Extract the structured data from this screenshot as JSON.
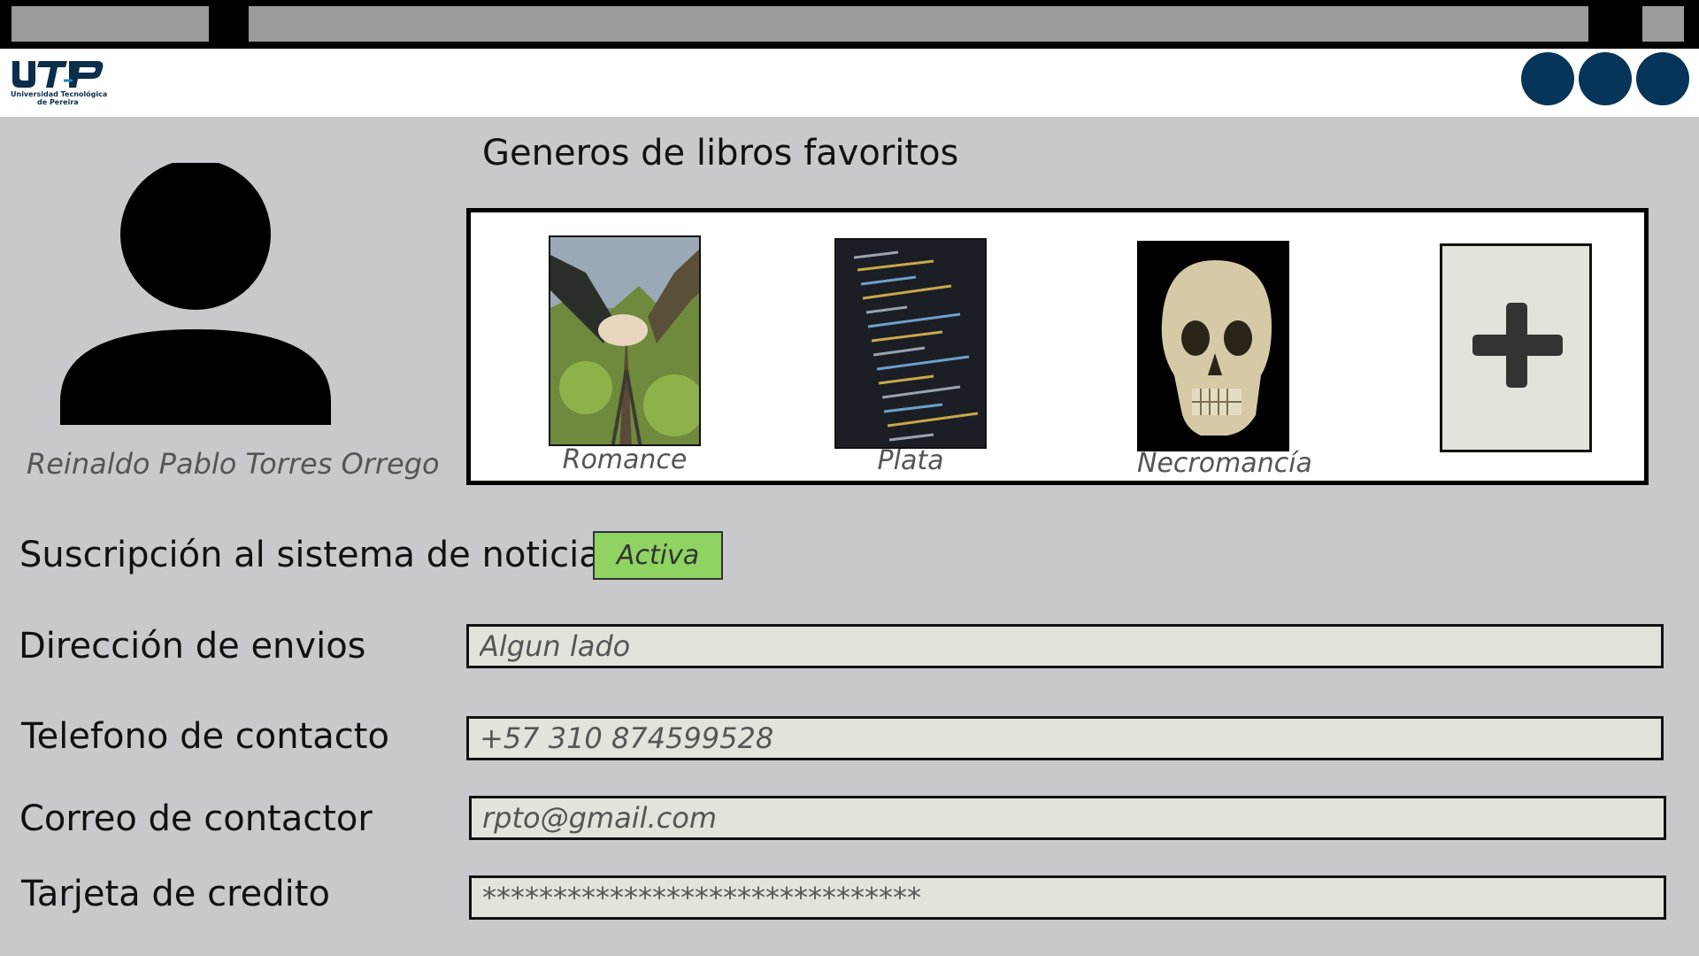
{
  "logo": {
    "text": "UTP",
    "subtitle_line1": "Universidad Tecnológica",
    "subtitle_line2": "de Pereira"
  },
  "profile": {
    "name": "Reinaldo Pablo Torres Orrego"
  },
  "genres": {
    "title": "Generos de libros favoritos",
    "items": [
      {
        "label": "Romance",
        "image": "hands-eiffel-tower-photo"
      },
      {
        "label": "Plata",
        "image": "code-screen-photo"
      },
      {
        "label": "Necromancía",
        "image": "skull-photo"
      }
    ],
    "add_icon": "plus-icon"
  },
  "subscription": {
    "label": "Suscripción al sistema de noticias",
    "status": "Activa",
    "status_color": "#8fd363"
  },
  "fields": {
    "address": {
      "label": "Dirección de envios",
      "value": "Algun lado"
    },
    "phone": {
      "label": "Telefono de contacto",
      "value": "+57 310 874599528"
    },
    "email": {
      "label": "Correo de contactor",
      "value": "rpto@gmail.com"
    },
    "card": {
      "label": "Tarjeta de credito",
      "value": "*******************************"
    }
  },
  "colors": {
    "brand": "#063559",
    "background": "#c8c9cd",
    "input_bg": "#e3e3dc"
  }
}
